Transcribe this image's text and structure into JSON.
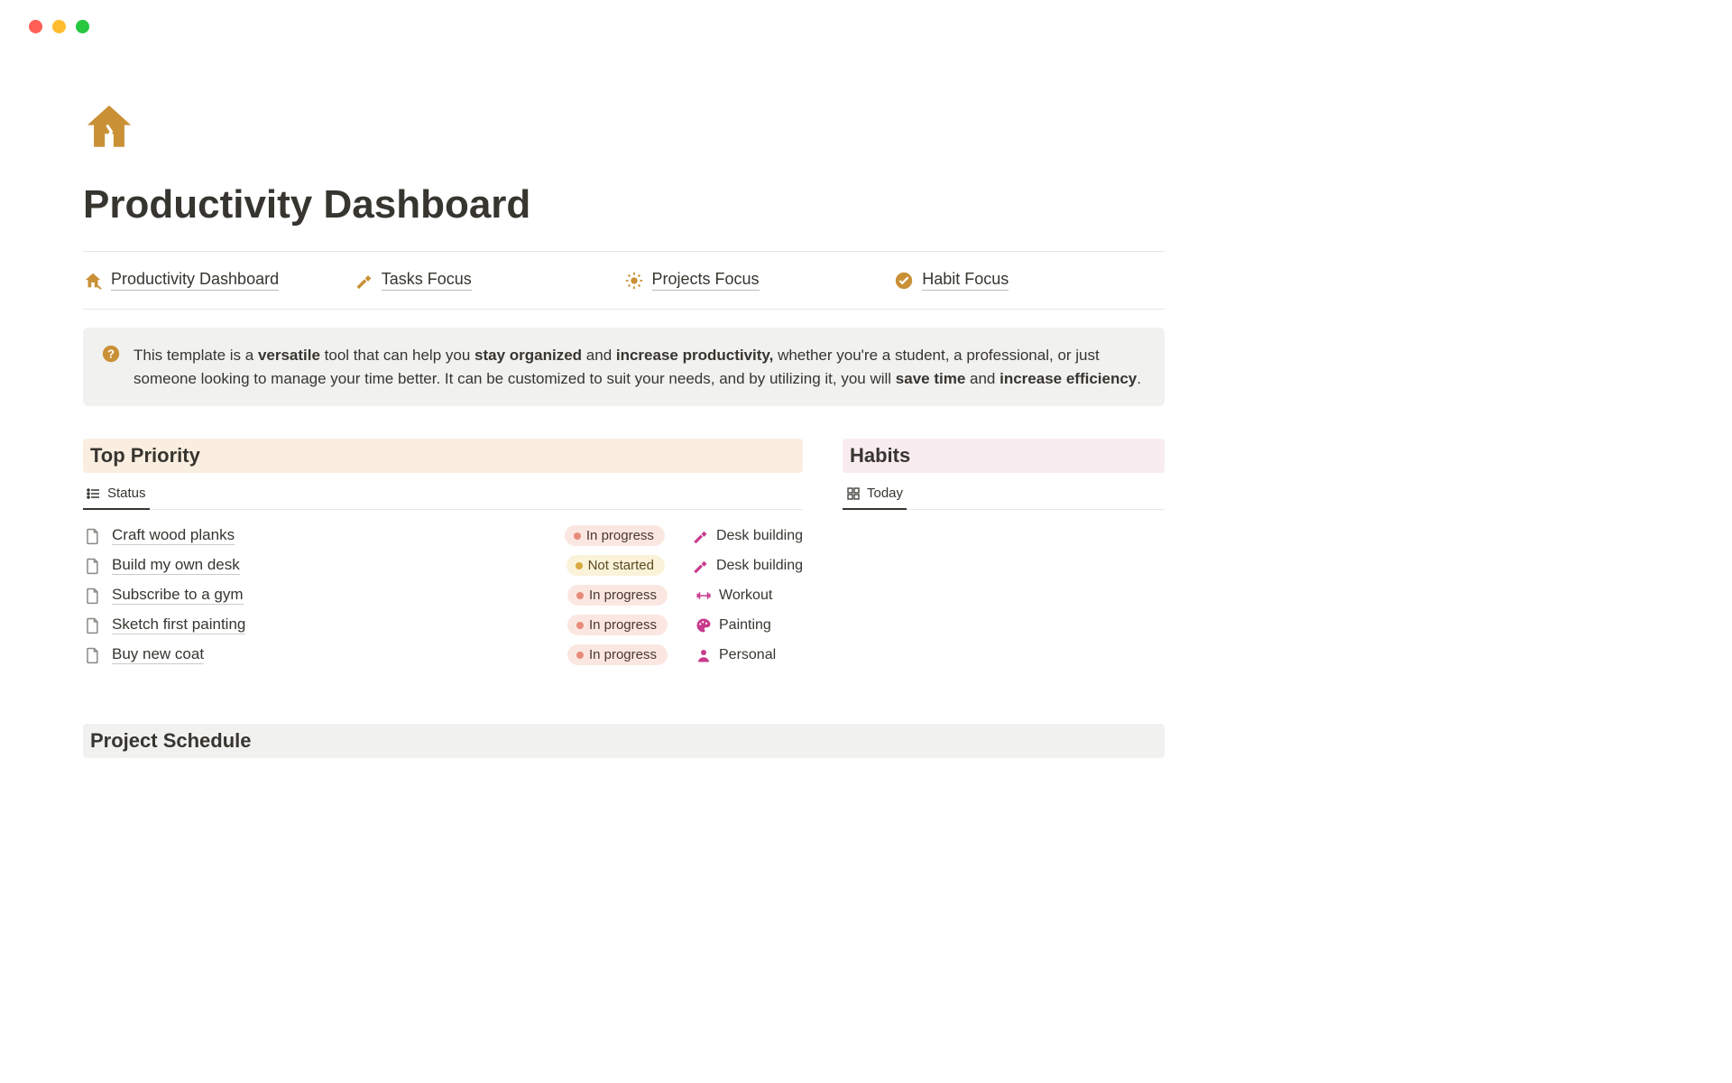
{
  "page": {
    "title": "Productivity Dashboard"
  },
  "nav": [
    {
      "label": "Productivity Dashboard",
      "iconColor": "#c99036"
    },
    {
      "label": "Tasks Focus",
      "iconColor": "#c99036"
    },
    {
      "label": "Projects Focus",
      "iconColor": "#c99036"
    },
    {
      "label": "Habit Focus",
      "iconColor": "#c99036"
    }
  ],
  "callout": {
    "text_parts": [
      "This template is a ",
      "versatile",
      " tool that can help you ",
      "stay organized",
      " and ",
      "increase productivity,",
      " whether you're a student, a professional, or just someone looking to manage your time better. It can be customized to suit your needs, and by utilizing it, you will ",
      "save time",
      " and ",
      "increase efficiency",
      "."
    ]
  },
  "sections": {
    "topPriority": {
      "title": "Top Priority",
      "tab": "Status"
    },
    "habits": {
      "title": "Habits",
      "tab": "Today"
    },
    "projectSchedule": {
      "title": "Project Schedule"
    }
  },
  "tasks": [
    {
      "title": "Craft wood planks",
      "status": "In progress",
      "statusType": "inprogress",
      "project": "Desk building",
      "projectIcon": "hammer",
      "projectColor": "#c93a8e"
    },
    {
      "title": "Build my own desk",
      "status": "Not started",
      "statusType": "notstarted",
      "project": "Desk building",
      "projectIcon": "hammer",
      "projectColor": "#c93a8e"
    },
    {
      "title": "Subscribe to a gym",
      "status": "In progress",
      "statusType": "inprogress",
      "project": "Workout",
      "projectIcon": "dumbbell",
      "projectColor": "#c93a8e"
    },
    {
      "title": "Sketch first painting",
      "status": "In progress",
      "statusType": "inprogress",
      "project": "Painting",
      "projectIcon": "palette",
      "projectColor": "#c93a8e"
    },
    {
      "title": "Buy new coat",
      "status": "In progress",
      "statusType": "inprogress",
      "project": "Personal",
      "projectIcon": "person",
      "projectColor": "#c93a8e"
    }
  ]
}
